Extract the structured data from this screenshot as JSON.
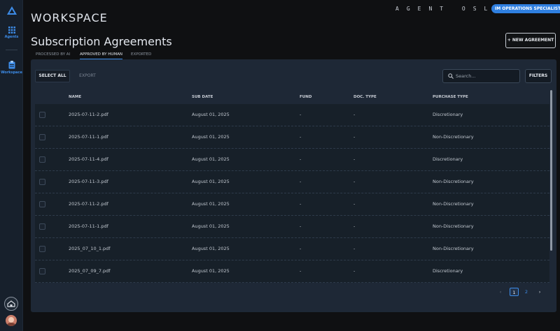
{
  "rail": {
    "items": [
      {
        "label": "Agents",
        "icon": "grid-icon"
      },
      {
        "label": "Workspace",
        "icon": "clipboard-icon"
      }
    ]
  },
  "header": {
    "title": "WORKSPACE",
    "agent_name": "AGENT OSLO",
    "role_badge": "IM OPERATIONS SPECIALIST",
    "page_title": "Subscription Agreements",
    "new_agreement_label": "+ NEW AGREEMENT"
  },
  "tabs": [
    {
      "label": "PROCESSED BY AI",
      "active": false
    },
    {
      "label": "APPROVED BY HUMAN",
      "active": true
    },
    {
      "label": "EXPORTED",
      "active": false
    }
  ],
  "toolbar": {
    "select_all_label": "SELECT ALL",
    "export_label": "EXPORT",
    "search_placeholder": "Search...",
    "filters_label": "FILTERS"
  },
  "table": {
    "columns": [
      "NAME",
      "SUB DATE",
      "FUND",
      "DOC. TYPE",
      "PURCHASE TYPE"
    ],
    "rows": [
      {
        "name": "2025-07-11-2.pdf",
        "sub_date": "August 01, 2025",
        "fund": "-",
        "doc_type": "-",
        "purchase_type": "Discretionary"
      },
      {
        "name": "2025-07-11-1.pdf",
        "sub_date": "August 01, 2025",
        "fund": "-",
        "doc_type": "-",
        "purchase_type": "Non-Discretionary"
      },
      {
        "name": "2025-07-11-4.pdf",
        "sub_date": "August 01, 2025",
        "fund": "-",
        "doc_type": "-",
        "purchase_type": "Discretionary"
      },
      {
        "name": "2025-07-11-3.pdf",
        "sub_date": "August 01, 2025",
        "fund": "-",
        "doc_type": "-",
        "purchase_type": "Non-Discretionary"
      },
      {
        "name": "2025-07-11-2.pdf",
        "sub_date": "August 01, 2025",
        "fund": "-",
        "doc_type": "-",
        "purchase_type": "Non-Discretionary"
      },
      {
        "name": "2025-07-11-1.pdf",
        "sub_date": "August 01, 2025",
        "fund": "-",
        "doc_type": "-",
        "purchase_type": "Non-Discretionary"
      },
      {
        "name": "2025_07_10_1.pdf",
        "sub_date": "August 01, 2025",
        "fund": "-",
        "doc_type": "-",
        "purchase_type": "Non-Discretionary"
      },
      {
        "name": "2025_07_09_7.pdf",
        "sub_date": "August 01, 2025",
        "fund": "-",
        "doc_type": "-",
        "purchase_type": "Discretionary"
      }
    ]
  },
  "pagination": {
    "prev": "‹",
    "pages": [
      "1",
      "2"
    ],
    "current": "1",
    "next": "›"
  },
  "colors": {
    "accent": "#2f7fe0",
    "background": "#0f1012",
    "panel": "#1e2836"
  }
}
